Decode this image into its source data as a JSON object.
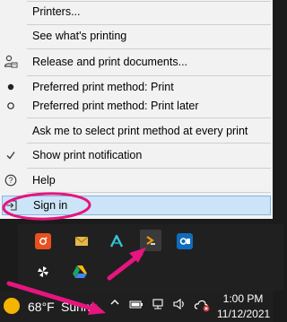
{
  "menu": {
    "items": [
      {
        "label": "Printers...",
        "icon": ""
      },
      {
        "label": "See what's printing",
        "icon": ""
      },
      {
        "label": "Release and print documents...",
        "icon": "user-print-icon"
      },
      {
        "label": "Preferred print method: Print",
        "icon": "radio-selected-icon"
      },
      {
        "label": "Preferred print method: Print later",
        "icon": "radio-unselected-icon"
      },
      {
        "label": "Ask me to select print method at every print",
        "icon": ""
      },
      {
        "label": "Show print notification",
        "icon": "checkmark-icon"
      },
      {
        "label": "Help",
        "icon": "help-icon"
      },
      {
        "label": "Sign in",
        "icon": "sign-in-icon"
      }
    ]
  },
  "tray_icons": [
    "orange-app-icon",
    "mail-icon",
    "arrow-logo-icon",
    "printer-app-icon",
    "outlook-icon",
    "pinwheel-icon",
    "google-drive-icon"
  ],
  "taskbar": {
    "temperature": "68°F",
    "condition": "Sunny",
    "time": "1:00 PM",
    "date": "11/12/2021"
  },
  "colors": {
    "annotation": "#e6157f",
    "highlight_bg": "#cce4f7",
    "taskbar_bg": "#1f1f1f"
  }
}
